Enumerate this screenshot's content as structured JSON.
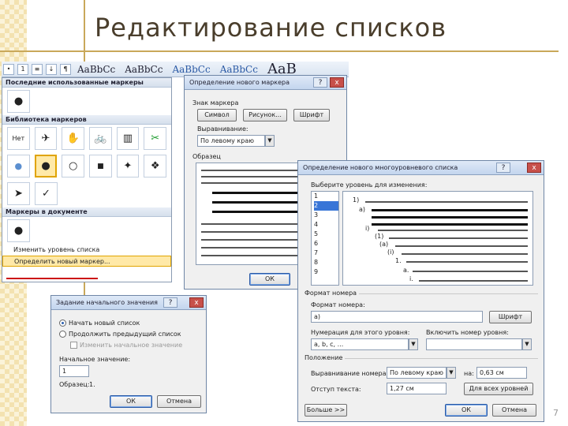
{
  "slide": {
    "title": "Редактирование списков",
    "slide_number": "7"
  },
  "ribbon": {
    "styles": [
      "AaBbCc",
      "AaBbCc",
      "AaBbCc",
      "AaBbCc",
      "AaB"
    ],
    "pilcrow": "¶"
  },
  "bullet_library": {
    "recent_header": "Последние использованные маркеры",
    "library_header": "Библиотека маркеров",
    "none_label": "Нет",
    "document_header": "Маркеры в документе",
    "change_level": "Изменить уровень списка",
    "define_new": "Определить новый маркер...",
    "recent_glyphs": [
      "●"
    ],
    "library_row1": [
      "✈",
      "✋",
      "🚲",
      "▥",
      "✂"
    ],
    "library_row2": [
      "●",
      "●",
      "○",
      "■",
      "✦",
      "❖"
    ],
    "library_row3": [
      "➤",
      "✓"
    ],
    "document_glyphs": [
      "●"
    ]
  },
  "bullet_dialog": {
    "title": "Определение нового маркера",
    "help": "?",
    "close": "x",
    "marker_label": "Знак маркера",
    "symbol_button": "Символ",
    "picture_button": "Рисунок...",
    "font_button": "Шрифт",
    "alignment_label": "Выравнивание:",
    "alignment_value": "По левому краю",
    "sample_label": "Образец",
    "ok_button": "ОК"
  },
  "multilevel_dialog": {
    "title": "Определение нового многоуровневого списка",
    "help": "?",
    "close": "x",
    "level_label": "Выберите уровень для изменения:",
    "levels": [
      "1",
      "2",
      "3",
      "4",
      "5",
      "6",
      "7",
      "8",
      "9"
    ],
    "selected_level": "2",
    "preview_numbers": [
      "1)",
      "a)",
      "i)",
      "(1)",
      "(a)",
      "(i)",
      "1.",
      "a.",
      "i."
    ],
    "number_format_header": "Формат номера",
    "number_format_label": "Формат номера:",
    "number_format_value": "a)",
    "font_button": "Шрифт",
    "numbering_style_label": "Нумерация для этого уровня:",
    "numbering_style_value": "a, b, c, ...",
    "include_level_label": "Включить номер уровня:",
    "position_header": "Положение",
    "number_align_label": "Выравнивание номера:",
    "number_align_value": "По левому краю",
    "at_label": "на:",
    "at_value": "0,63 см",
    "text_indent_label": "Отступ текста:",
    "text_indent_value": "1,27 см",
    "all_levels_button": "Для всех уровней",
    "more_button": "Больше >>",
    "ok_button": "ОК",
    "cancel_button": "Отмена"
  },
  "start_dialog": {
    "title": "Задание начального значения",
    "help": "?",
    "close": "x",
    "new_list": "Начать новый список",
    "continue_list": "Продолжить предыдущий список",
    "advance_value": "Изменить начальное значение",
    "start_value_label": "Начальное значение:",
    "start_value": "1",
    "preview_label": "Образец:",
    "preview_value": "1.",
    "ok_button": "ОК",
    "cancel_button": "Отмена"
  }
}
